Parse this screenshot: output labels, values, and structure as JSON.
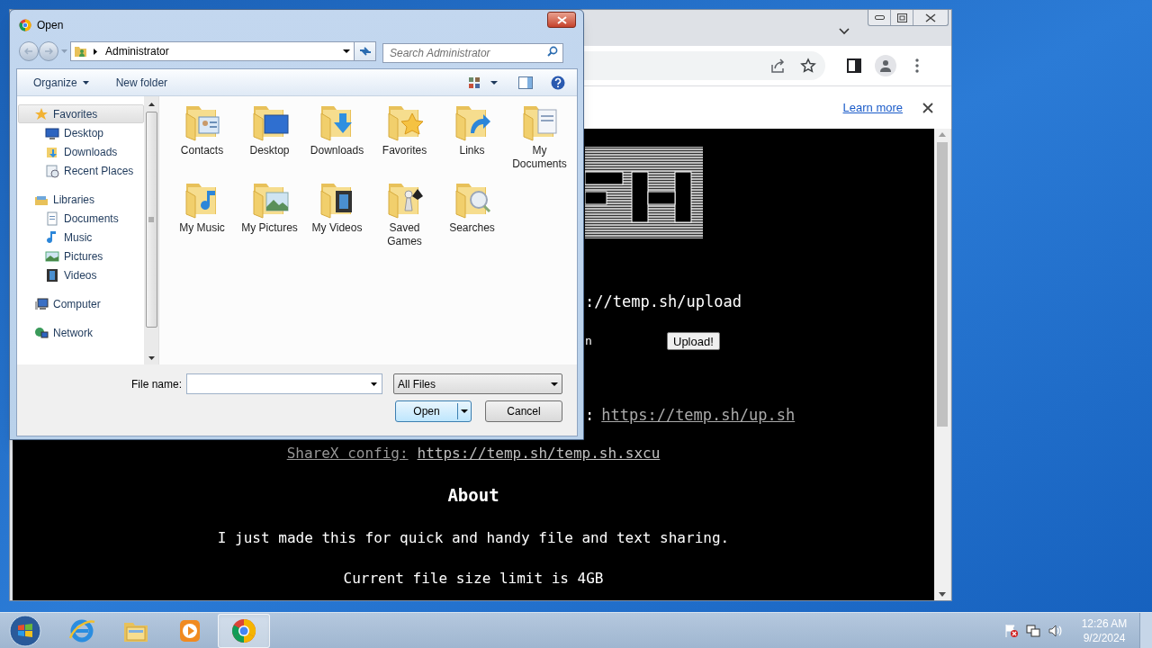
{
  "browser": {
    "infobar": {
      "link": "Learn more"
    },
    "page": {
      "upload_url": "://temp.sh/upload",
      "form_fragment": "n",
      "upload_button": "Upload!",
      "script_colon": ":",
      "script_link": "https://temp.sh/up.sh",
      "sharex_label": "ShareX config:",
      "sharex_link": "https://temp.sh/temp.sh.sxcu",
      "about_heading": "About",
      "about_text": "I just made this for quick and handy file and text sharing.",
      "limit_text": "Current file size limit is 4GB"
    }
  },
  "dialog": {
    "title": "Open",
    "address": "Administrator",
    "search": {
      "placeholder": "Search Administrator"
    },
    "toolbar": {
      "organize": "Organize",
      "new_folder": "New folder"
    },
    "nav": [
      {
        "label": "Favorites",
        "kind": "star",
        "selected": true,
        "children": [
          {
            "label": "Desktop",
            "kind": "desktop",
            "selected": false
          },
          {
            "label": "Downloads",
            "kind": "downloads",
            "selected": false
          },
          {
            "label": "Recent Places",
            "kind": "recent",
            "selected": false
          }
        ]
      },
      {
        "label": "Libraries",
        "kind": "library",
        "selected": false,
        "children": [
          {
            "label": "Documents",
            "kind": "documents",
            "selected": false
          },
          {
            "label": "Music",
            "kind": "music",
            "selected": false
          },
          {
            "label": "Pictures",
            "kind": "pictures",
            "selected": false
          },
          {
            "label": "Videos",
            "kind": "videos",
            "selected": false
          }
        ]
      },
      {
        "label": "Computer",
        "kind": "computer",
        "selected": false
      },
      {
        "label": "Network",
        "kind": "network",
        "selected": false
      }
    ],
    "folders": [
      {
        "label": "Contacts",
        "kind": "contacts"
      },
      {
        "label": "Desktop",
        "kind": "desktop"
      },
      {
        "label": "Downloads",
        "kind": "downloads"
      },
      {
        "label": "Favorites",
        "kind": "favorites"
      },
      {
        "label": "Links",
        "kind": "links"
      },
      {
        "label": "My Documents",
        "kind": "documents"
      },
      {
        "label": "My Music",
        "kind": "music"
      },
      {
        "label": "My Pictures",
        "kind": "pictures"
      },
      {
        "label": "My Videos",
        "kind": "videos"
      },
      {
        "label": "Saved Games",
        "kind": "games"
      },
      {
        "label": "Searches",
        "kind": "searches"
      }
    ],
    "file_name_label": "File name:",
    "file_type": "All Files",
    "open_button": "Open",
    "cancel_button": "Cancel"
  },
  "taskbar": {
    "apps": [
      {
        "kind": "ie",
        "selected": false
      },
      {
        "kind": "explorer",
        "selected": false
      },
      {
        "kind": "media",
        "selected": false
      },
      {
        "kind": "chrome",
        "selected": true
      }
    ],
    "time": "12:26 AM",
    "date": "9/2/2024"
  }
}
